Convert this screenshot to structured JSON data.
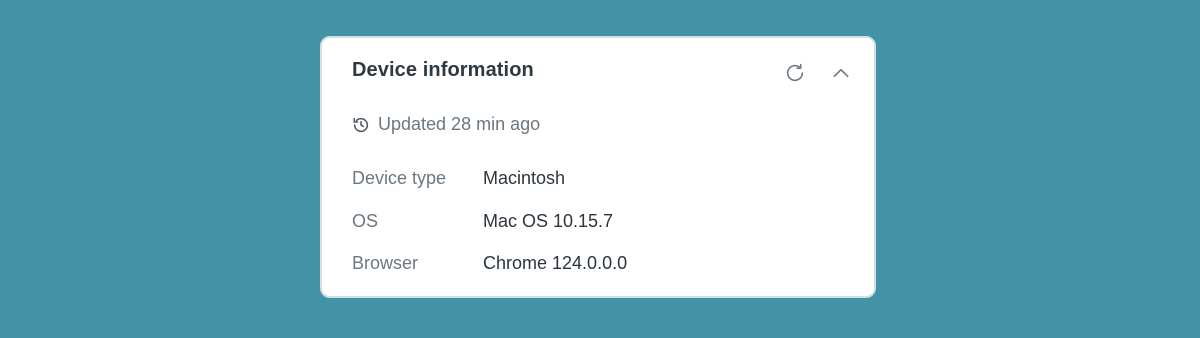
{
  "card": {
    "title": "Device information",
    "updated_text": "Updated 28 min ago",
    "actions": {
      "refresh_icon": "refresh-icon",
      "collapse_icon": "chevron-up-icon"
    },
    "history_icon": "history-icon",
    "rows": [
      {
        "label": "Device type",
        "value": "Macintosh"
      },
      {
        "label": "OS",
        "value": "Mac OS 10.15.7"
      },
      {
        "label": "Browser",
        "value": "Chrome 124.0.0.0"
      }
    ]
  },
  "colors": {
    "background": "#4393a7",
    "card": "#ffffff",
    "title": "#2e3a43",
    "muted": "#6c7780",
    "value": "#2b353d"
  }
}
